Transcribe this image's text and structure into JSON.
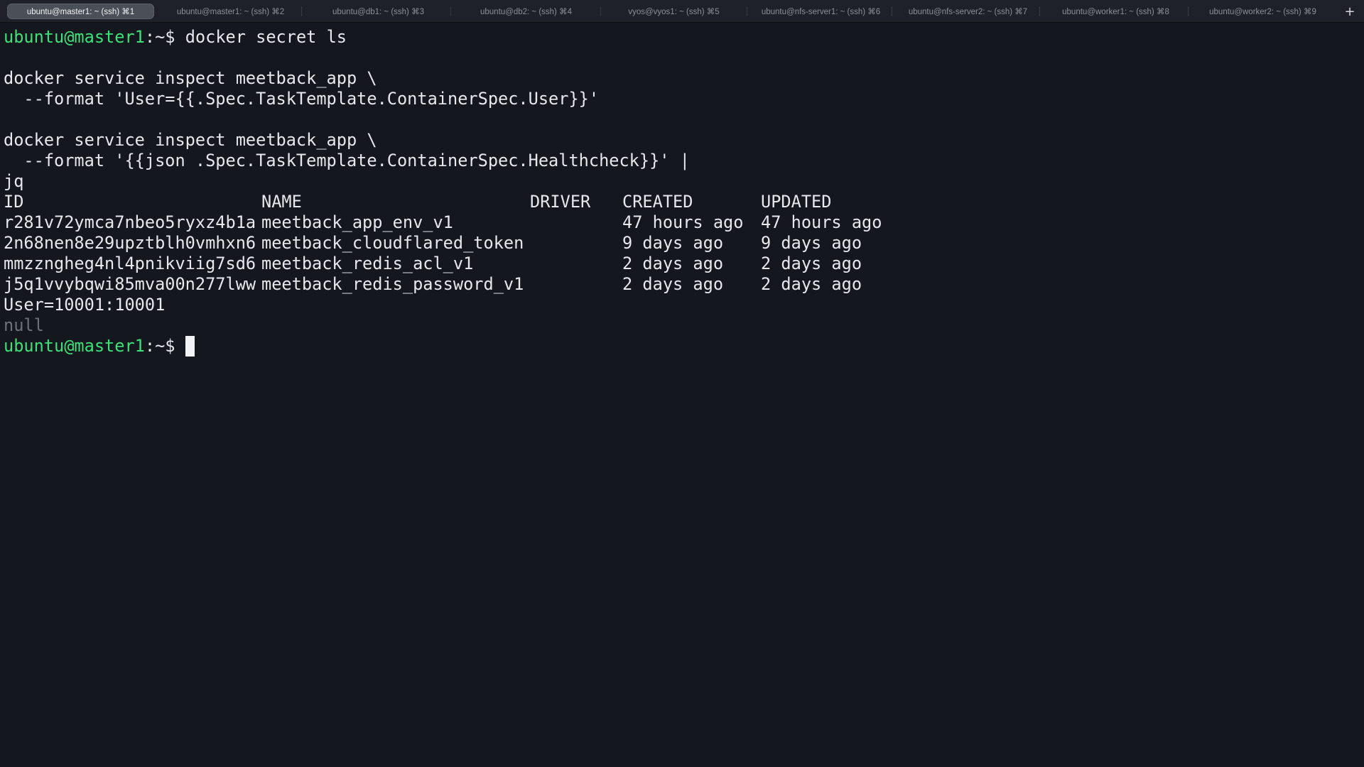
{
  "tabs": [
    {
      "label": "ubuntu@master1: ~ (ssh) ⌘1",
      "active": true
    },
    {
      "label": "ubuntu@master1: ~ (ssh) ⌘2",
      "active": false
    },
    {
      "label": "ubuntu@db1: ~ (ssh) ⌘3",
      "active": false
    },
    {
      "label": "ubuntu@db2: ~ (ssh) ⌘4",
      "active": false
    },
    {
      "label": "vyos@vyos1: ~ (ssh) ⌘5",
      "active": false
    },
    {
      "label": "ubuntu@nfs-server1: ~ (ssh) ⌘6",
      "active": false
    },
    {
      "label": "ubuntu@nfs-server2: ~ (ssh) ⌘7",
      "active": false
    },
    {
      "label": "ubuntu@worker1: ~ (ssh) ⌘8",
      "active": false
    },
    {
      "label": "ubuntu@worker2: ~ (ssh) ⌘9",
      "active": false
    }
  ],
  "new_tab_icon": "+",
  "terminal": {
    "prompt": {
      "user_host": "ubuntu@master1",
      "path": ":~$"
    },
    "command1": " docker secret ls",
    "command2_line1": "docker service inspect meetback_app \\",
    "command2_line2": "  --format 'User={{.Spec.TaskTemplate.ContainerSpec.User}}'",
    "command3_line1": "docker service inspect meetback_app \\",
    "command3_line2": "  --format '{{json .Spec.TaskTemplate.ContainerSpec.Healthcheck}}' |",
    "command3_line3": "jq",
    "table": {
      "headers": [
        "ID",
        "NAME",
        "DRIVER",
        "CREATED",
        "UPDATED"
      ],
      "rows": [
        [
          "r281v72ymca7nbeo5ryxz4b1a",
          "meetback_app_env_v1",
          "",
          "47 hours ago",
          "47 hours ago"
        ],
        [
          "2n68nen8e29upztblh0vmhxn6",
          "meetback_cloudflared_token",
          "",
          "9 days ago",
          "9 days ago"
        ],
        [
          "mmzzngheg4nl4pnikviig7sd6",
          "meetback_redis_acl_v1",
          "",
          "2 days ago",
          "2 days ago"
        ],
        [
          "j5q1vvybqwi85mva00n277lww",
          "meetback_redis_password_v1",
          "",
          "2 days ago",
          "2 days ago"
        ]
      ]
    },
    "output_user": "User=10001:10001",
    "output_null": "null",
    "colors": {
      "background": "#14171d",
      "prompt_user": "#3ee07a",
      "text": "#e6e8ec",
      "muted": "#6e7178"
    }
  }
}
